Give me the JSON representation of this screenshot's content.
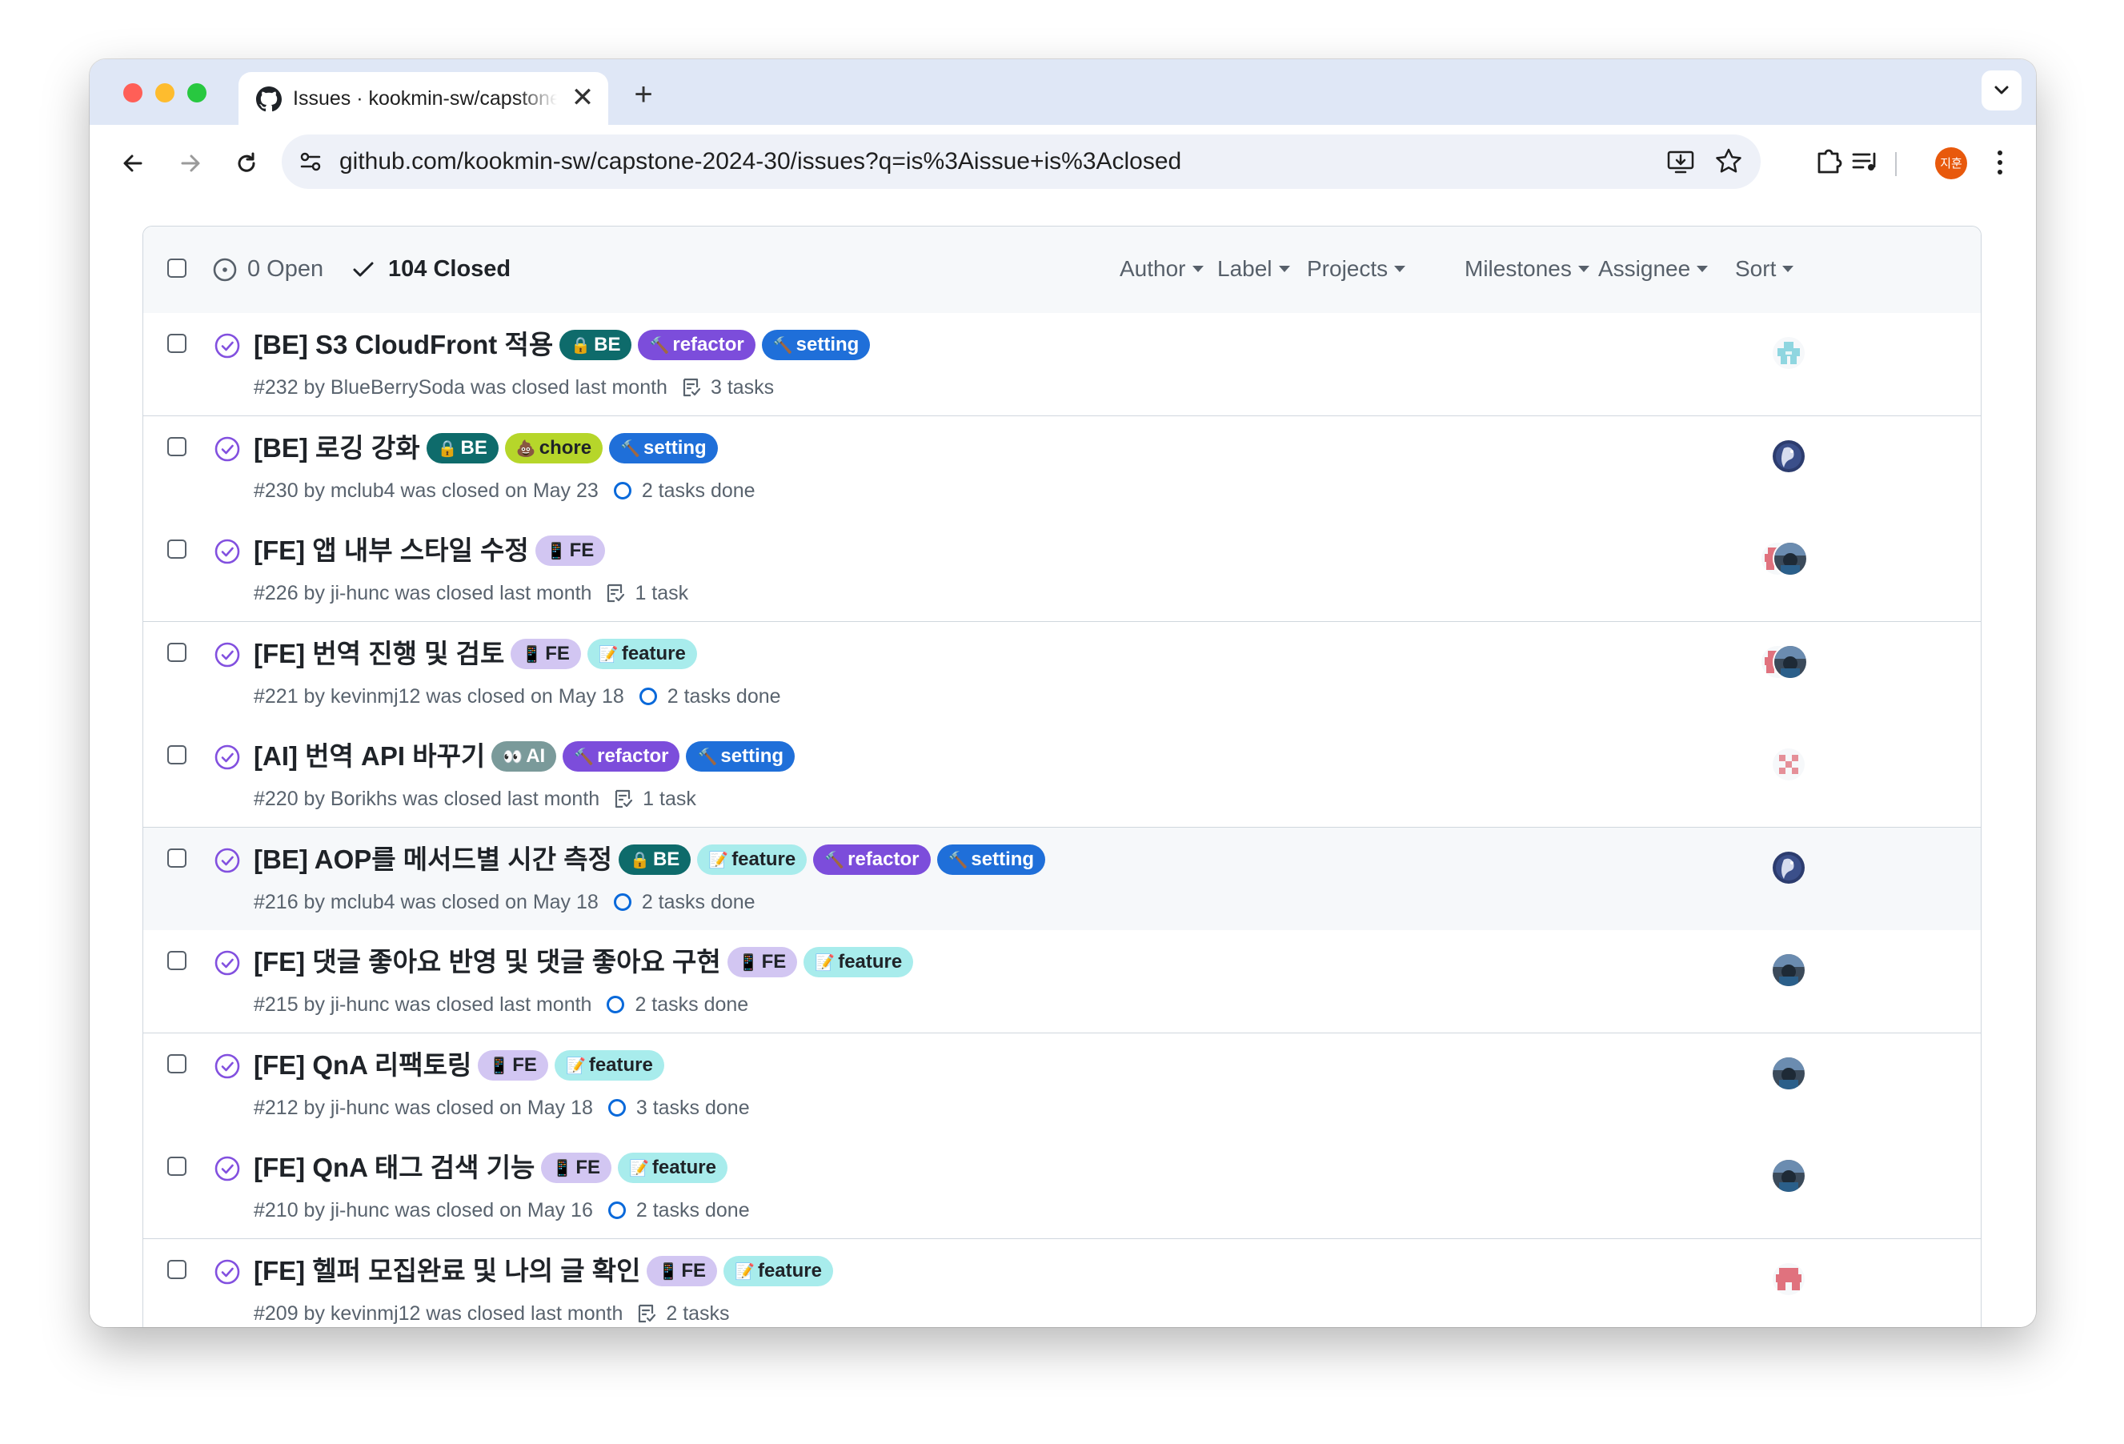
{
  "browser": {
    "tab_title": "Issues · kookmin-sw/capstone-2024-30",
    "tab_close": "✕",
    "new_tab": "+",
    "url": "github.com/kookmin-sw/capstone-2024-30/issues?q=is%3Aissue+is%3Aclosed",
    "profile_initials": "지훈"
  },
  "list_header": {
    "open_label": "0 Open",
    "closed_label": "104 Closed",
    "filters": [
      "Author",
      "Label",
      "Projects",
      "Milestones",
      "Assignee",
      "Sort"
    ]
  },
  "label_styles": {
    "BE": {
      "bg": "#0e6b6b",
      "fg": "#ffffff"
    },
    "FE": {
      "bg": "#d2c6f2",
      "fg": "#1f2328"
    },
    "AI": {
      "bg": "#7a9a9a",
      "fg": "#ffffff"
    },
    "refactor": {
      "bg": "#7c4ddb",
      "fg": "#ffffff"
    },
    "setting": {
      "bg": "#1f6fd9",
      "fg": "#ffffff"
    },
    "chore": {
      "bg": "#b6d62a",
      "fg": "#1f2328"
    },
    "feature": {
      "bg": "#a8ecec",
      "fg": "#1f2328"
    }
  },
  "label_emoji": {
    "BE": "🔒",
    "FE": "📱",
    "AI": "👀",
    "refactor": "🔨",
    "setting": "🔨",
    "chore": "💩",
    "feature": "📝"
  },
  "issues": [
    {
      "title": "[BE] S3 CloudFront 적용",
      "labels": [
        "BE",
        "refactor",
        "setting"
      ],
      "meta": "#232 by BlueBerrySoda was closed last month",
      "task_type": "list",
      "tasks": "3 tasks",
      "avatar": "teal"
    },
    {
      "title": "[BE] 로깅 강화",
      "labels": [
        "BE",
        "chore",
        "setting"
      ],
      "meta": "#230 by mclub4 was closed on May 23",
      "task_type": "progress",
      "tasks": "2 tasks done",
      "avatar": "navy"
    },
    {
      "title": "[FE] 앱 내부 스타일 수정",
      "labels": [
        "FE"
      ],
      "meta": "#226 by ji-hunc was closed last month",
      "task_type": "list",
      "tasks": "1 task",
      "avatar": "dual"
    },
    {
      "title": "[FE] 번역 진행 및 검토",
      "labels": [
        "FE",
        "feature"
      ],
      "meta": "#221 by kevinmj12 was closed on May 18",
      "task_type": "progress",
      "tasks": "2 tasks done",
      "avatar": "dual"
    },
    {
      "title": "[AI] 번역 API 바꾸기",
      "labels": [
        "AI",
        "refactor",
        "setting"
      ],
      "meta": "#220 by Borikhs was closed last month",
      "task_type": "list",
      "tasks": "1 task",
      "avatar": "pink"
    },
    {
      "title": "[BE] AOP를 메서드별 시간 측정",
      "labels": [
        "BE",
        "feature",
        "refactor",
        "setting"
      ],
      "meta": "#216 by mclub4 was closed on May 18",
      "task_type": "progress",
      "tasks": "2 tasks done",
      "avatar": "navy"
    },
    {
      "title": "[FE] 댓글 좋아요 반영 및 댓글 좋아요 구현",
      "labels": [
        "FE",
        "feature"
      ],
      "meta": "#215 by ji-hunc was closed last month",
      "task_type": "progress",
      "tasks": "2 tasks done",
      "avatar": "photo"
    },
    {
      "title": "[FE] QnA 리팩토링",
      "labels": [
        "FE",
        "feature"
      ],
      "meta": "#212 by ji-hunc was closed on May 18",
      "task_type": "progress",
      "tasks": "3 tasks done",
      "avatar": "photo"
    },
    {
      "title": "[FE] QnA 태그 검색 기능",
      "labels": [
        "FE",
        "feature"
      ],
      "meta": "#210 by ji-hunc was closed on May 16",
      "task_type": "progress",
      "tasks": "2 tasks done",
      "avatar": "photo"
    },
    {
      "title": "[FE] 헬퍼 모집완료 및 나의 글 확인",
      "labels": [
        "FE",
        "feature"
      ],
      "meta": "#209 by kevinmj12 was closed last month",
      "task_type": "list",
      "tasks": "2 tasks",
      "avatar": "red"
    }
  ]
}
